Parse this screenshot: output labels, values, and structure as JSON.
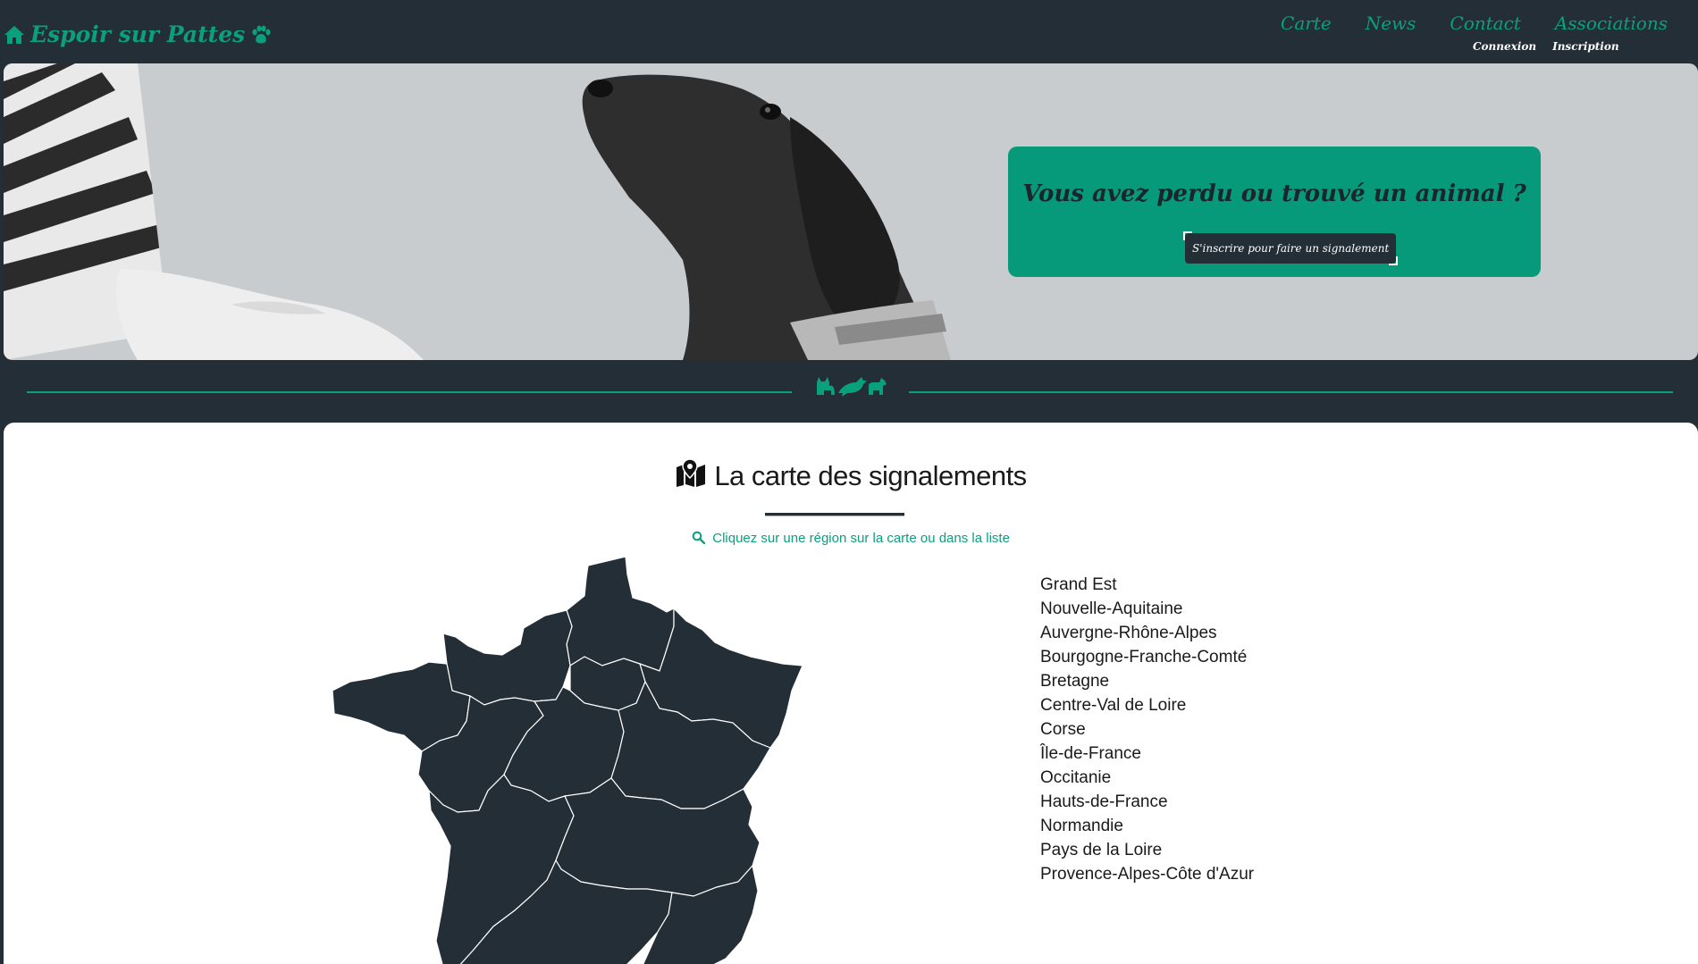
{
  "header": {
    "brand": "Espoir sur Pattes",
    "nav": [
      "Carte",
      "News",
      "Contact",
      "Associations"
    ],
    "auth": [
      "Connexion",
      "Inscription"
    ]
  },
  "hero": {
    "title": "Vous avez perdu ou trouvé un animal ?",
    "button": "S'inscrire pour faire un signalement"
  },
  "map_section": {
    "title": "La carte des signalements",
    "hint": "Cliquez sur une région sur la carte ou dans la liste",
    "regions": [
      "Grand Est",
      "Nouvelle-Aquitaine",
      "Auvergne-Rhône-Alpes",
      "Bourgogne-Franche-Comté",
      "Bretagne",
      "Centre-Val de Loire",
      "Corse",
      "Île-de-France",
      "Occitanie",
      "Hauts-de-France",
      "Normandie",
      "Pays de la Loire",
      "Provence-Alpes-Côte d'Azur"
    ]
  },
  "colors": {
    "dark": "#232e37",
    "accent": "#0aa07e",
    "cta": "#079a7a",
    "hero_bg": "#c9cccf"
  },
  "icons": [
    "home-icon",
    "paw-icon",
    "map-marked-icon",
    "search-icon",
    "cat-icon",
    "bird-icon",
    "dog-icon"
  ]
}
